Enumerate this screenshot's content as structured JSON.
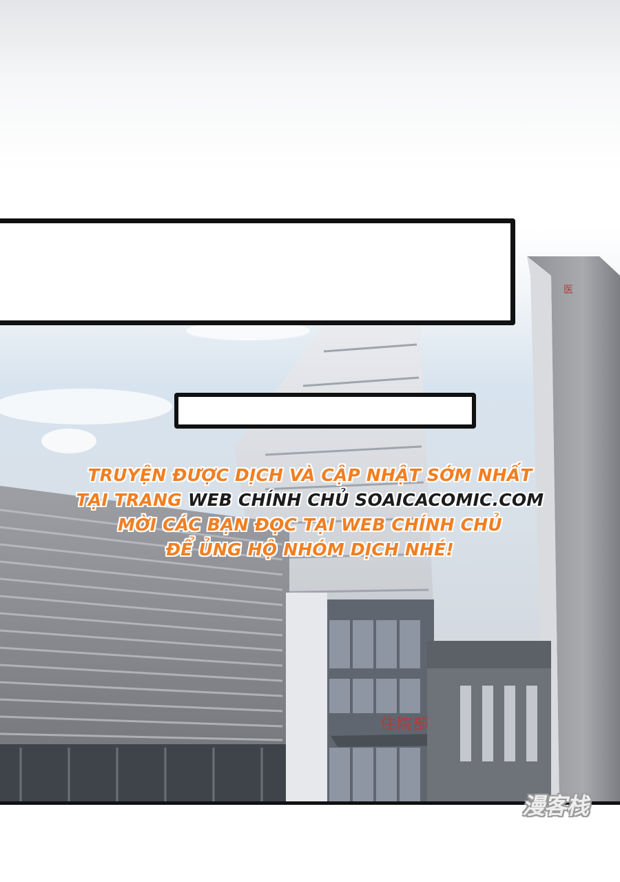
{
  "notice": {
    "line1": "TRUYỆN ĐƯỢC DỊCH VÀ CẬP NHẬT SỚM NHẤT",
    "line2_prefix": "TẠI TRANG ",
    "line2_highlight": "WEB CHÍNH CHỦ SOAICACOMIC.COM",
    "line3": "MỜI CÁC BẠN ĐỌC TẠI WEB CHÍNH CHỦ",
    "line4": "ĐỂ ỦNG HỘ NHÓM DỊCH NHÉ!"
  },
  "building_sign": "住院部",
  "watermark": "漫客栈",
  "colors": {
    "notice_orange": "#f07f22",
    "notice_dark": "#1c1c1c",
    "frame": "#111111",
    "sign_red": "#b53a3a"
  }
}
